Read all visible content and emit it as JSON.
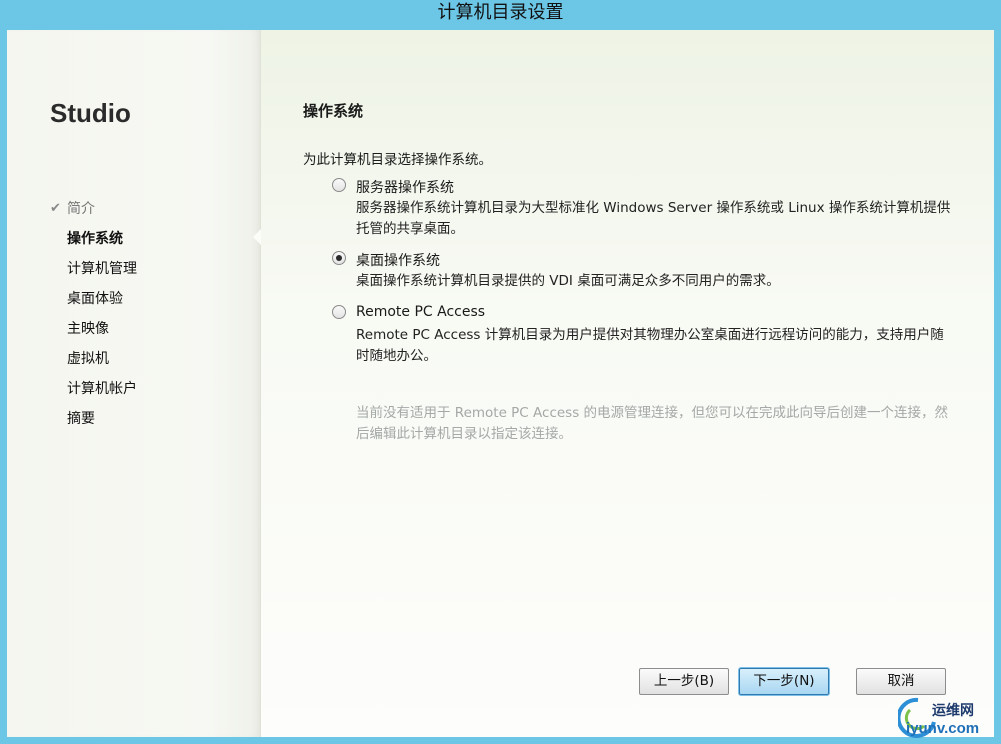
{
  "window": {
    "title": "计算机目录设置"
  },
  "sidebar": {
    "brand": "Studio",
    "items": [
      {
        "label": "简介",
        "state": "done"
      },
      {
        "label": "操作系统",
        "state": "active"
      },
      {
        "label": "计算机管理",
        "state": "pending"
      },
      {
        "label": "桌面体验",
        "state": "pending"
      },
      {
        "label": "主映像",
        "state": "pending"
      },
      {
        "label": "虚拟机",
        "state": "pending"
      },
      {
        "label": "计算机帐户",
        "state": "pending"
      },
      {
        "label": "摘要",
        "state": "pending"
      }
    ],
    "check_glyph": "✔"
  },
  "main": {
    "heading": "操作系统",
    "prompt": "为此计算机目录选择操作系统。",
    "options": [
      {
        "label": "服务器操作系统",
        "description": "服务器操作系统计算机目录为大型标准化 Windows Server 操作系统或 Linux 操作系统计算机提供托管的共享桌面。",
        "checked": false
      },
      {
        "label": "桌面操作系统",
        "description": "桌面操作系统计算机目录提供的 VDI 桌面可满足众多不同用户的需求。",
        "checked": true
      },
      {
        "label": "Remote PC Access",
        "description": "Remote PC Access 计算机目录为用户提供对其物理办公室桌面进行远程访问的能力，支持用户随时随地办公。",
        "checked": false
      }
    ],
    "note": "当前没有适用于 Remote PC Access 的电源管理连接，但您可以在完成此向导后创建一个连接，然后编辑此计算机目录以指定该连接。"
  },
  "footer": {
    "back_label": "上一步(B)",
    "next_label": "下一步(N)",
    "cancel_label": "取消"
  },
  "watermark": {
    "line1": "运维网",
    "line2": "iyunv.com"
  }
}
